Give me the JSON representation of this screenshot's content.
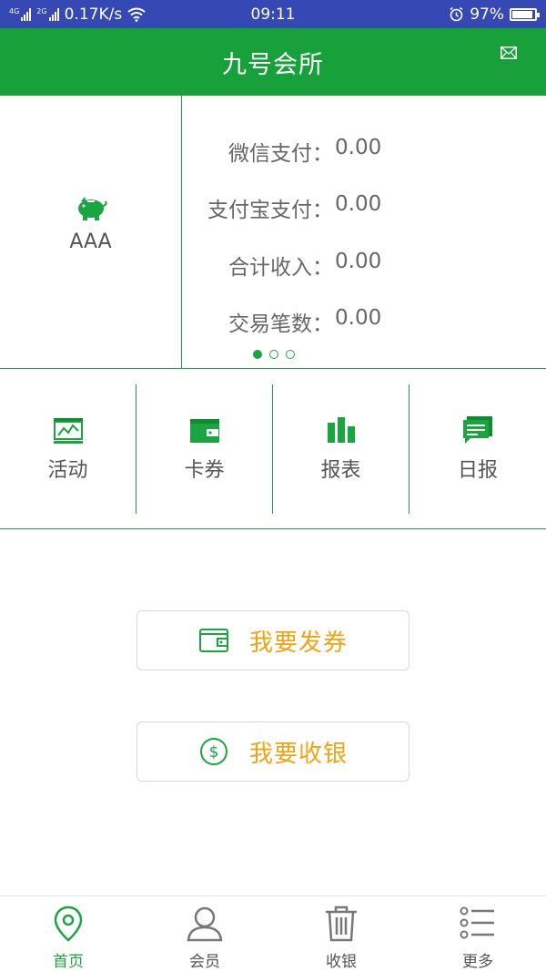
{
  "status_bar": {
    "net1": "4G",
    "net2": "2G",
    "speed": "0.17K/s",
    "time": "09:11",
    "battery": "97%"
  },
  "header": {
    "title": "九号会所"
  },
  "store": {
    "name": "AAA"
  },
  "stats": [
    {
      "label": "微信支付：",
      "value": "0.00"
    },
    {
      "label": "支付宝支付：",
      "value": "0.00"
    },
    {
      "label": "合计收入：",
      "value": "0.00"
    },
    {
      "label": "交易笔数：",
      "value": "0.00"
    }
  ],
  "pager": {
    "current": 1,
    "total": 3
  },
  "grid": [
    {
      "label": "活动",
      "icon": "activity-chart-icon"
    },
    {
      "label": "卡券",
      "icon": "wallet-card-icon"
    },
    {
      "label": "报表",
      "icon": "bar-chart-icon"
    },
    {
      "label": "日报",
      "icon": "daily-report-icon"
    }
  ],
  "actions": {
    "issue_coupon": "我要发券",
    "cashier": "我要收银"
  },
  "tabs": [
    {
      "label": "首页",
      "icon": "location-pin-icon",
      "active": true
    },
    {
      "label": "会员",
      "icon": "member-person-icon",
      "active": false
    },
    {
      "label": "收银",
      "icon": "trash-bin-icon",
      "active": false
    },
    {
      "label": "更多",
      "icon": "list-menu-icon",
      "active": false
    }
  ],
  "colors": {
    "status_bar": "#3548b4",
    "brand_green": "#18a03b",
    "accent_orange": "#f0a415"
  }
}
